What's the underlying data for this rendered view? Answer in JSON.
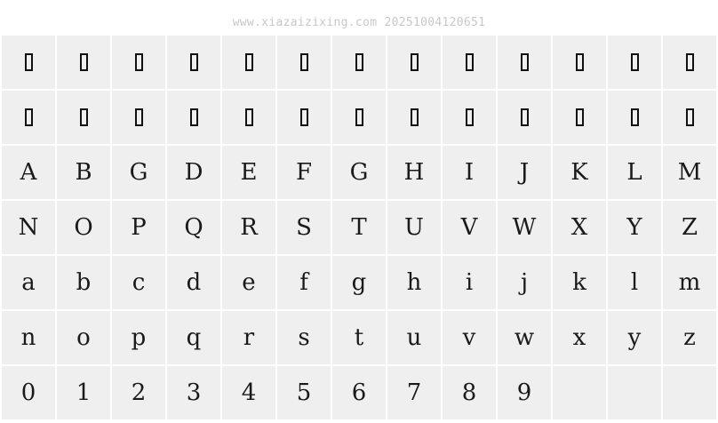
{
  "watermark": "www.xiazaizixing.com 20251004120651",
  "rows": [
    [
      "□",
      "□",
      "□",
      "□",
      "□",
      "□",
      "□",
      "□",
      "□",
      "□",
      "□",
      "□",
      "□"
    ],
    [
      "□",
      "□",
      "□",
      "□",
      "□",
      "□",
      "□",
      "□",
      "□",
      "□",
      "□",
      "□",
      "□"
    ],
    [
      "A",
      "B",
      "G",
      "D",
      "E",
      "F",
      "G",
      "H",
      "I",
      "J",
      "K",
      "L",
      "M"
    ],
    [
      "N",
      "O",
      "P",
      "Q",
      "R",
      "S",
      "T",
      "U",
      "V",
      "W",
      "X",
      "Y",
      "Z"
    ],
    [
      "a",
      "b",
      "c",
      "d",
      "e",
      "f",
      "g",
      "h",
      "i",
      "j",
      "k",
      "l",
      "m"
    ],
    [
      "n",
      "o",
      "p",
      "q",
      "r",
      "s",
      "t",
      "u",
      "v",
      "w",
      "x",
      "y",
      "z"
    ],
    [
      "0",
      "1",
      "2",
      "3",
      "4",
      "5",
      "6",
      "7",
      "8",
      "9",
      "",
      "",
      ""
    ]
  ]
}
